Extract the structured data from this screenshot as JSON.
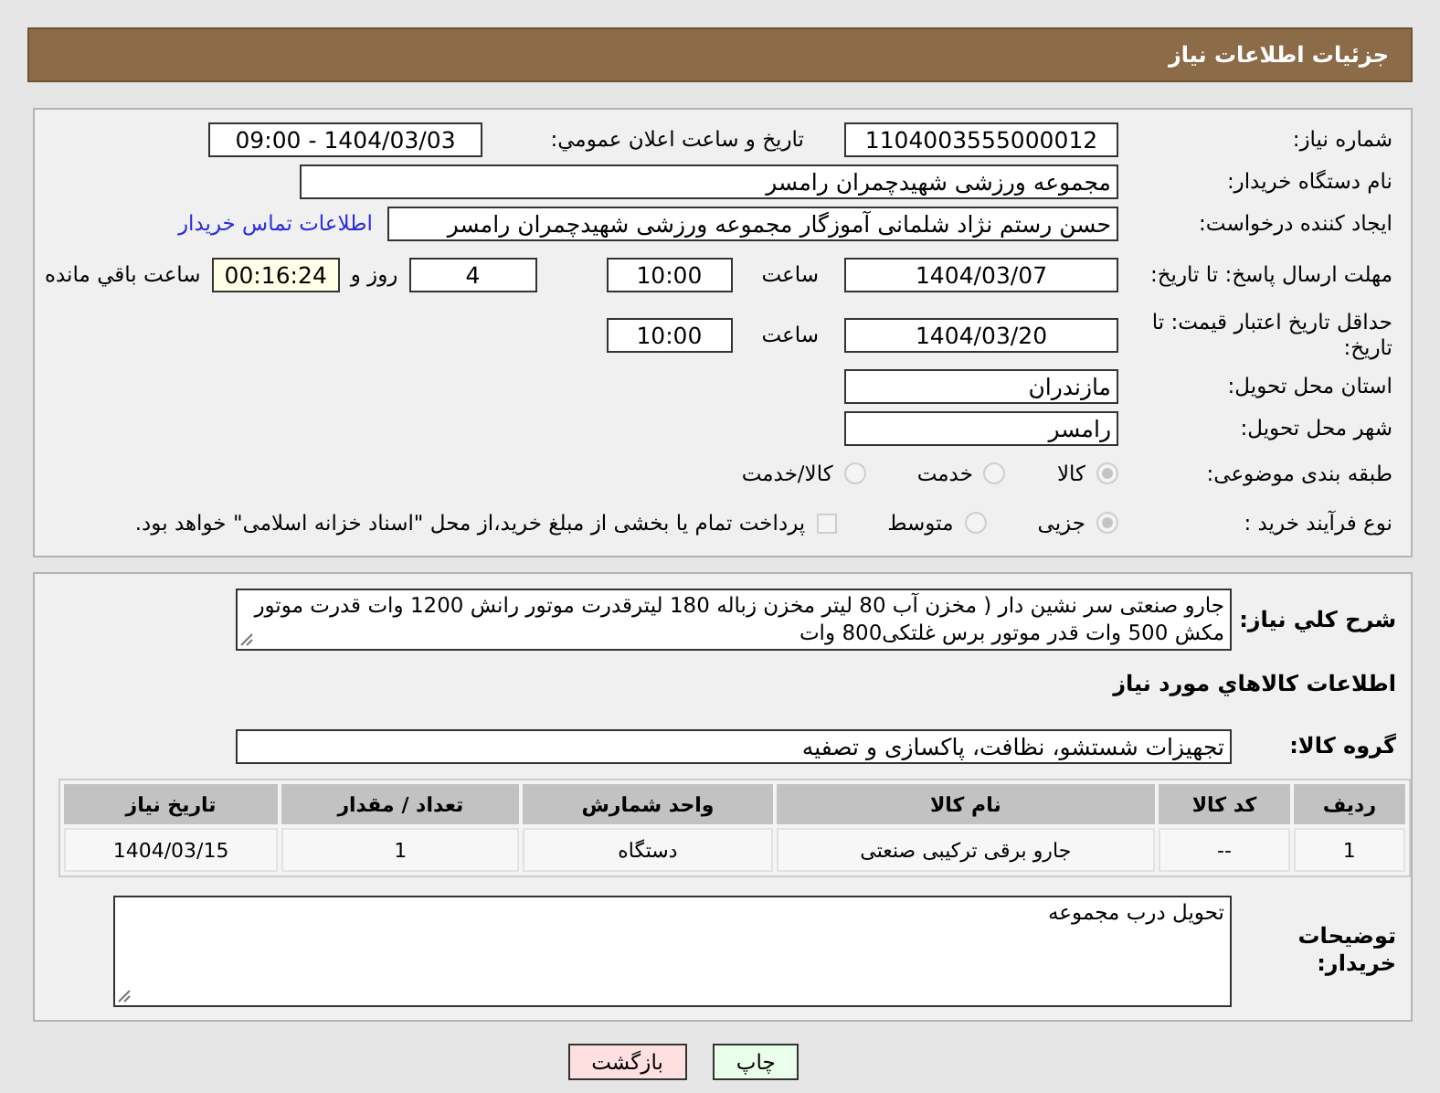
{
  "header": {
    "title": "جزئیات اطلاعات نیاز"
  },
  "need_number": {
    "label": "شماره نیاز:",
    "value": "1104003555000012"
  },
  "announce": {
    "label": "تاریخ و ساعت اعلان عمومي:",
    "value": "1404/03/03 - 09:00"
  },
  "buyer_org": {
    "label": "نام دستگاه خریدار:",
    "value": "مجموعه ورزشی شهیدچمران رامسر"
  },
  "creator": {
    "label": "ایجاد کننده درخواست:",
    "value": "حسن رستم نژاد شلمانی آموزگار مجموعه ورزشی شهیدچمران رامسر",
    "link": "اطلاعات تماس خریدار"
  },
  "reply_deadline": {
    "label": "مهلت ارسال پاسخ: تا تاریخ:",
    "date": "1404/03/07",
    "time_label": "ساعت",
    "time": "10:00",
    "days": "4",
    "days_label": "روز و",
    "remaining": "00:16:24",
    "remaining_label": "ساعت باقي مانده"
  },
  "price_validity": {
    "label": "حداقل تاریخ اعتبار قیمت: تا تاریخ:",
    "date": "1404/03/20",
    "time_label": "ساعت",
    "time": "10:00"
  },
  "province": {
    "label": "استان محل تحویل:",
    "value": "مازندران"
  },
  "city": {
    "label": "شهر محل تحویل:",
    "value": "رامسر"
  },
  "category": {
    "label": "طبقه بندی موضوعی:",
    "options": [
      {
        "label": "کالا",
        "selected": true
      },
      {
        "label": "خدمت",
        "selected": false
      },
      {
        "label": "کالا/خدمت",
        "selected": false
      }
    ]
  },
  "process": {
    "label": "نوع فرآیند خرید :",
    "options": [
      {
        "label": "جزیی",
        "selected": true
      },
      {
        "label": "متوسط",
        "selected": false
      }
    ],
    "treasury": {
      "label": "پرداخت تمام یا بخشی از مبلغ خرید،از محل \"اسناد خزانه اسلامی\" خواهد بود.",
      "checked": false
    }
  },
  "description": {
    "label": "شرح کلي نیاز:",
    "value": "جارو صنعتی سر نشین دار ( مخزن آب 80 لیتر مخزن زباله 180 لیترقدرت موتور رانش 1200 وات قدرت موتور مکش 500 وات قدر موتور برس غلتکی800 وات"
  },
  "goods_title": "اطلاعات کالاهاي مورد نیاز",
  "goods_group": {
    "label": "گروه کالا:",
    "value": "تجهیزات شستشو، نظافت، پاکسازی و تصفیه"
  },
  "table": {
    "columns": [
      "ردیف",
      "کد کالا",
      "نام کالا",
      "واحد شمارش",
      "تعداد / مقدار",
      "تاریخ نیاز"
    ],
    "rows": [
      [
        "1",
        "--",
        "جارو برقی ترکیبی صنعتی",
        "دستگاه",
        "1",
        "1404/03/15"
      ]
    ]
  },
  "buyer_notes": {
    "label": "توضیحات خریدار:",
    "value": "تحویل درب مجموعه"
  },
  "buttons": [
    {
      "label": "چاپ",
      "kind": "print"
    },
    {
      "label": "بازگشت",
      "kind": "back"
    }
  ]
}
